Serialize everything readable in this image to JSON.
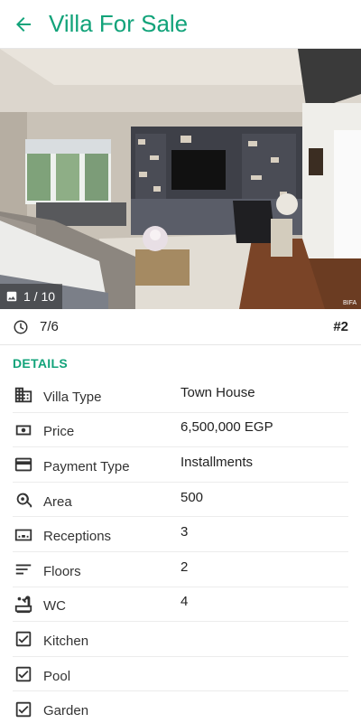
{
  "appbar": {
    "title": "Villa For Sale"
  },
  "gallery": {
    "counter_text": "1 / 10",
    "watermark": "BIFA"
  },
  "listing_meta": {
    "date": "7/6",
    "rank": "#2"
  },
  "details": {
    "section_title": "DETAILS",
    "rows": [
      {
        "icon": "building-icon",
        "label": "Villa Type",
        "value": "Town House"
      },
      {
        "icon": "cash-icon",
        "label": "Price",
        "value": "6,500,000 EGP"
      },
      {
        "icon": "credit-card-icon",
        "label": "Payment Type",
        "value": "Installments"
      },
      {
        "icon": "tape-measure-icon",
        "label": "Area",
        "value": "500"
      },
      {
        "icon": "sofa-icon",
        "label": "Receptions",
        "value": "3"
      },
      {
        "icon": "floors-icon",
        "label": "Floors",
        "value": "2"
      },
      {
        "icon": "bathtub-icon",
        "label": "WC",
        "value": "4"
      },
      {
        "icon": "checkbox-icon",
        "label": "Kitchen",
        "value": ""
      },
      {
        "icon": "checkbox-icon",
        "label": "Pool",
        "value": ""
      },
      {
        "icon": "checkbox-icon",
        "label": "Garden",
        "value": ""
      }
    ]
  },
  "colors": {
    "accent": "#12a37a",
    "icon": "#333333"
  }
}
